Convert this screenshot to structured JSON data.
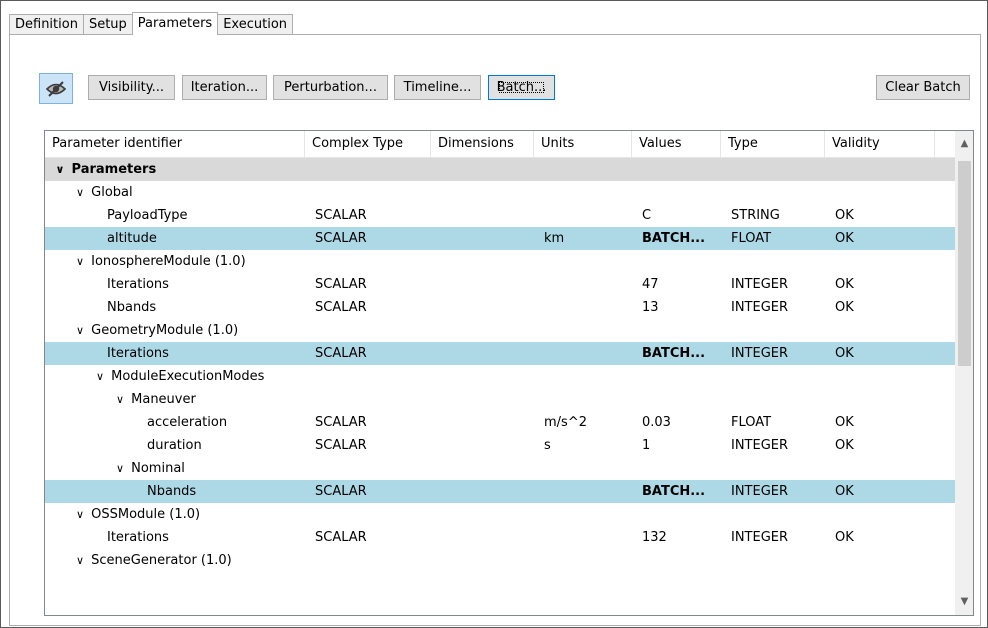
{
  "tabs": [
    {
      "label": "Definition"
    },
    {
      "label": "Setup"
    },
    {
      "label": "Parameters",
      "active": true
    },
    {
      "label": "Execution"
    }
  ],
  "toolbar": {
    "visibility_toggle_icon": "eye-slash-icon",
    "visibility": "Visibility...",
    "iteration": "Iteration...",
    "perturbation": "Perturbation...",
    "timeline": "Timeline...",
    "batch": "Batch...",
    "clear_batch": "Clear Batch"
  },
  "table": {
    "columns": [
      "Parameter identifier",
      "Complex Type",
      "Dimensions",
      "Units",
      "Values",
      "Type",
      "Validity"
    ],
    "rows": [
      {
        "indent": 0,
        "expand": true,
        "name": "Parameters",
        "kind": "group"
      },
      {
        "indent": 1,
        "expand": true,
        "name": "Global"
      },
      {
        "indent": 2,
        "name": "PayloadType",
        "complex": "SCALAR",
        "dims": "",
        "units": "",
        "values": "C",
        "type": "STRING",
        "validity": "OK"
      },
      {
        "indent": 2,
        "name": "altitude",
        "complex": "SCALAR",
        "dims": "",
        "units": "km",
        "values": "BATCH...",
        "type": "FLOAT",
        "validity": "OK",
        "selected": true,
        "bold_value": true
      },
      {
        "indent": 1,
        "expand": true,
        "name": "IonosphereModule (1.0)"
      },
      {
        "indent": 2,
        "name": "Iterations",
        "complex": "SCALAR",
        "dims": "",
        "units": "",
        "values": "47",
        "type": "INTEGER",
        "validity": "OK"
      },
      {
        "indent": 2,
        "name": "Nbands",
        "complex": "SCALAR",
        "dims": "",
        "units": "",
        "values": "13",
        "type": "INTEGER",
        "validity": "OK"
      },
      {
        "indent": 1,
        "expand": true,
        "name": "GeometryModule (1.0)"
      },
      {
        "indent": 2,
        "name": "Iterations",
        "complex": "SCALAR",
        "dims": "",
        "units": "",
        "values": "BATCH...",
        "type": "INTEGER",
        "validity": "OK",
        "selected": true,
        "bold_value": true
      },
      {
        "indent": 2,
        "expand": true,
        "name": "ModuleExecutionModes"
      },
      {
        "indent": 3,
        "expand": true,
        "name": "Maneuver"
      },
      {
        "indent": 4,
        "name": "acceleration",
        "complex": "SCALAR",
        "dims": "",
        "units": "m/s^2",
        "values": "0.03",
        "type": "FLOAT",
        "validity": "OK"
      },
      {
        "indent": 4,
        "name": "duration",
        "complex": "SCALAR",
        "dims": "",
        "units": "s",
        "values": "1",
        "type": "INTEGER",
        "validity": "OK"
      },
      {
        "indent": 3,
        "expand": true,
        "name": "Nominal"
      },
      {
        "indent": 4,
        "name": "Nbands",
        "complex": "SCALAR",
        "dims": "",
        "units": "",
        "values": "BATCH...",
        "type": "INTEGER",
        "validity": "OK",
        "selected": true,
        "bold_value": true
      },
      {
        "indent": 1,
        "expand": true,
        "name": "OSSModule (1.0)"
      },
      {
        "indent": 2,
        "name": "Iterations",
        "complex": "SCALAR",
        "dims": "",
        "units": "",
        "values": "132",
        "type": "INTEGER",
        "validity": "OK"
      },
      {
        "indent": 1,
        "expand": true,
        "name": "SceneGenerator (1.0)"
      }
    ]
  },
  "colors": {
    "selected_row": "#add8e6",
    "group_row": "#d9d9d9",
    "button_bg": "#e1e1e1",
    "toggle_bg": "#cce4f7"
  }
}
